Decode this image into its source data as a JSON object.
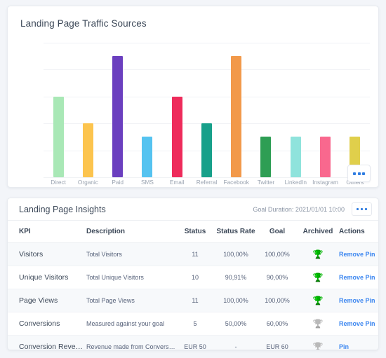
{
  "chart_card": {
    "title": "Landing Page Traffic Sources",
    "menu_icon": "kebab-menu-icon"
  },
  "chart_data": {
    "type": "bar",
    "title": "Landing Page Traffic Sources",
    "xlabel": "",
    "ylabel": "",
    "ylim": [
      0,
      50
    ],
    "yticks": [
      0,
      10,
      20,
      30,
      40,
      50
    ],
    "grid": true,
    "legend": "none",
    "categories": [
      "Direct",
      "Organic",
      "Paid",
      "SMS",
      "Email",
      "Referral",
      "Facebook",
      "Twitter",
      "LinkedIn",
      "Instagram",
      "Others"
    ],
    "values": [
      30,
      20,
      45,
      15,
      30,
      20,
      45,
      15,
      15,
      15,
      15
    ],
    "colors": [
      "#a9e8b6",
      "#fcc44e",
      "#6b3fbf",
      "#55c3f0",
      "#ee2b5b",
      "#17a08a",
      "#f2994a",
      "#2e9e54",
      "#8fe3dc",
      "#f9688e",
      "#e0cf4b"
    ]
  },
  "insights_card": {
    "title": "Landing Page Insights",
    "goal_duration": "Goal Duration: 2021/01/01 10:00",
    "menu_icon": "kebab-menu-icon",
    "columns": [
      "KPI",
      "Description",
      "Status",
      "Status Rate",
      "Goal",
      "Archived",
      "Actions"
    ],
    "rows": [
      {
        "kpi": "Visitors",
        "description": "Total Visitors",
        "status": "11",
        "status_rate": "100,00%",
        "goal": "100,00%",
        "archived": "won",
        "action": "Remove Pin"
      },
      {
        "kpi": "Unique Visitors",
        "description": "Total Unique Visitors",
        "status": "10",
        "status_rate": "90,91%",
        "goal": "90,00%",
        "archived": "won",
        "action": "Remove Pin"
      },
      {
        "kpi": "Page Views",
        "description": "Total Page Views",
        "status": "11",
        "status_rate": "100,00%",
        "goal": "100,00%",
        "archived": "won",
        "action": "Remove Pin"
      },
      {
        "kpi": "Conversions",
        "description": "Measured against your goal",
        "status": "5",
        "status_rate": "50,00%",
        "goal": "60,00%",
        "archived": "none",
        "action": "Remove Pin"
      },
      {
        "kpi": "Conversion Revenue",
        "description": "Revenue made from Conversions",
        "status": "EUR 50",
        "status_rate": "-",
        "goal": "EUR 60",
        "archived": "none",
        "action": "Pin"
      }
    ]
  },
  "colors": {
    "accent_link": "#3b86f0",
    "trophy_won": "#2aa35f",
    "trophy_none": "#d9dee6",
    "page_bg": "#f3f5f9"
  }
}
